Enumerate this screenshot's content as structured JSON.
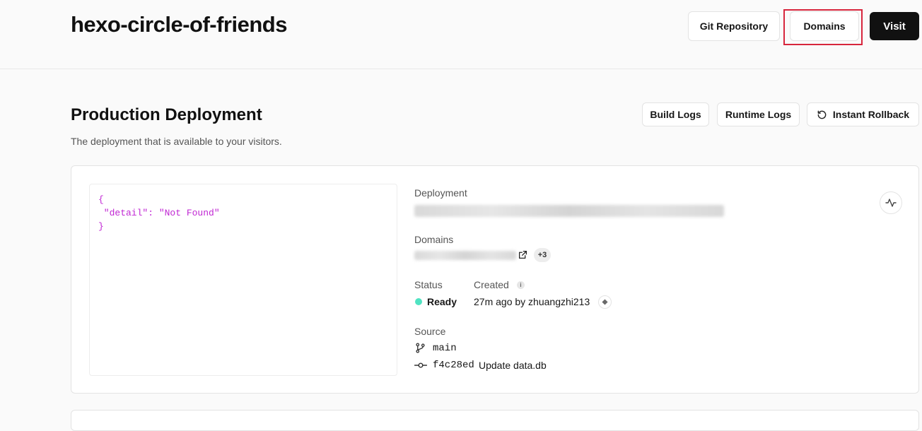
{
  "project": {
    "title": "hexo-circle-of-friends"
  },
  "header_actions": {
    "git_label": "Git Repository",
    "domains_label": "Domains",
    "visit_label": "Visit"
  },
  "section": {
    "title": "Production Deployment",
    "description": "The deployment that is available to your visitors.",
    "build_logs_label": "Build Logs",
    "runtime_logs_label": "Runtime Logs",
    "rollback_label": "Instant Rollback"
  },
  "preview": {
    "lines": [
      "{",
      " \"detail\": \"Not Found\"",
      "}"
    ]
  },
  "details": {
    "deployment_label": "Deployment",
    "domains_label": "Domains",
    "domains_extra": "+3",
    "status_label": "Status",
    "status_value": "Ready",
    "created_label": "Created",
    "created_value": "27m ago by zhuangzhi213",
    "source_label": "Source",
    "branch": "main",
    "commit_hash": "f4c28ed",
    "commit_message": "Update data.db"
  },
  "colors": {
    "ready": "#50e3c2",
    "json": "#c026d3",
    "highlight": "#d7263d"
  }
}
